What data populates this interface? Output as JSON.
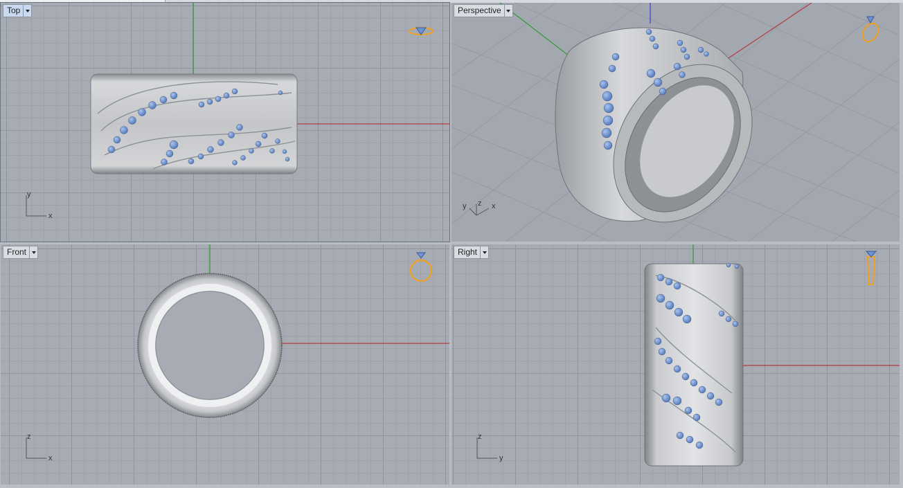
{
  "top_strip": {
    "tabs": 3
  },
  "viewports": {
    "top": {
      "label": "Top",
      "axis_h": "x",
      "axis_v": "y",
      "active": true
    },
    "perspective": {
      "label": "Perspective",
      "axis_labels": [
        "y",
        "z",
        "x"
      ]
    },
    "front": {
      "label": "Front",
      "axis_h": "x",
      "axis_v": "z"
    },
    "right": {
      "label": "Right",
      "axis_h": "y",
      "axis_v": "z"
    }
  },
  "colors": {
    "viewport_bg": "#a7acb4",
    "grid_major": "#8f949c",
    "grid_minor": "#9ea3ab",
    "x_axis": "#b33a3a",
    "y_axis": "#2e9a2e",
    "z_axis": "#3a3ad0",
    "metal": "#c4c6c9",
    "gem": "#6d93d2",
    "view_icon": "#f0a020"
  },
  "icons": {
    "top": "ring-top-view-icon",
    "perspective": "ring-perspective-view-icon",
    "front": "ring-front-view-icon",
    "right": "ring-right-view-icon"
  }
}
